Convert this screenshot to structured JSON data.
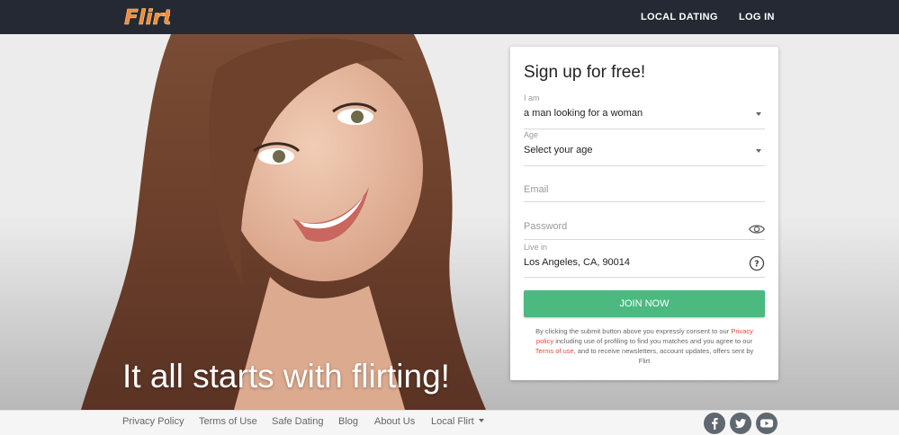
{
  "brand": {
    "logo_text": "Flirt",
    "logo_color": "#f28a3c"
  },
  "header": {
    "nav": [
      "LOCAL DATING",
      "LOG IN"
    ]
  },
  "hero": {
    "tagline": "It all starts with flirting!"
  },
  "signup": {
    "title": "Sign up for free!",
    "i_am": {
      "label": "I am",
      "value": "a man looking for a woman"
    },
    "age": {
      "label": "Age",
      "value": "Select your age"
    },
    "email": {
      "placeholder": "Email"
    },
    "password": {
      "placeholder": "Password",
      "icon": "eye-icon"
    },
    "live_in": {
      "label": "Live in",
      "value": "Los Angeles, CA, 90014",
      "icon": "help-icon"
    },
    "submit_label": "JOIN NOW",
    "submit_color": "#4cba80",
    "consent": {
      "part1": "By clicking the submit button above you expressly consent to our",
      "privacy_link": "Privacy policy",
      "part2": "including use of profiling to find you matches and you agree to our",
      "terms_link": "Terms of use",
      "part3": ", and to receive newsletters, account updates, offers sent by Flirt"
    }
  },
  "footer": {
    "links": [
      "Privacy Policy",
      "Terms of Use",
      "Safe Dating",
      "Blog",
      "About Us",
      "Local Flirt"
    ],
    "social": [
      "facebook-icon",
      "twitter-icon",
      "youtube-icon"
    ]
  }
}
